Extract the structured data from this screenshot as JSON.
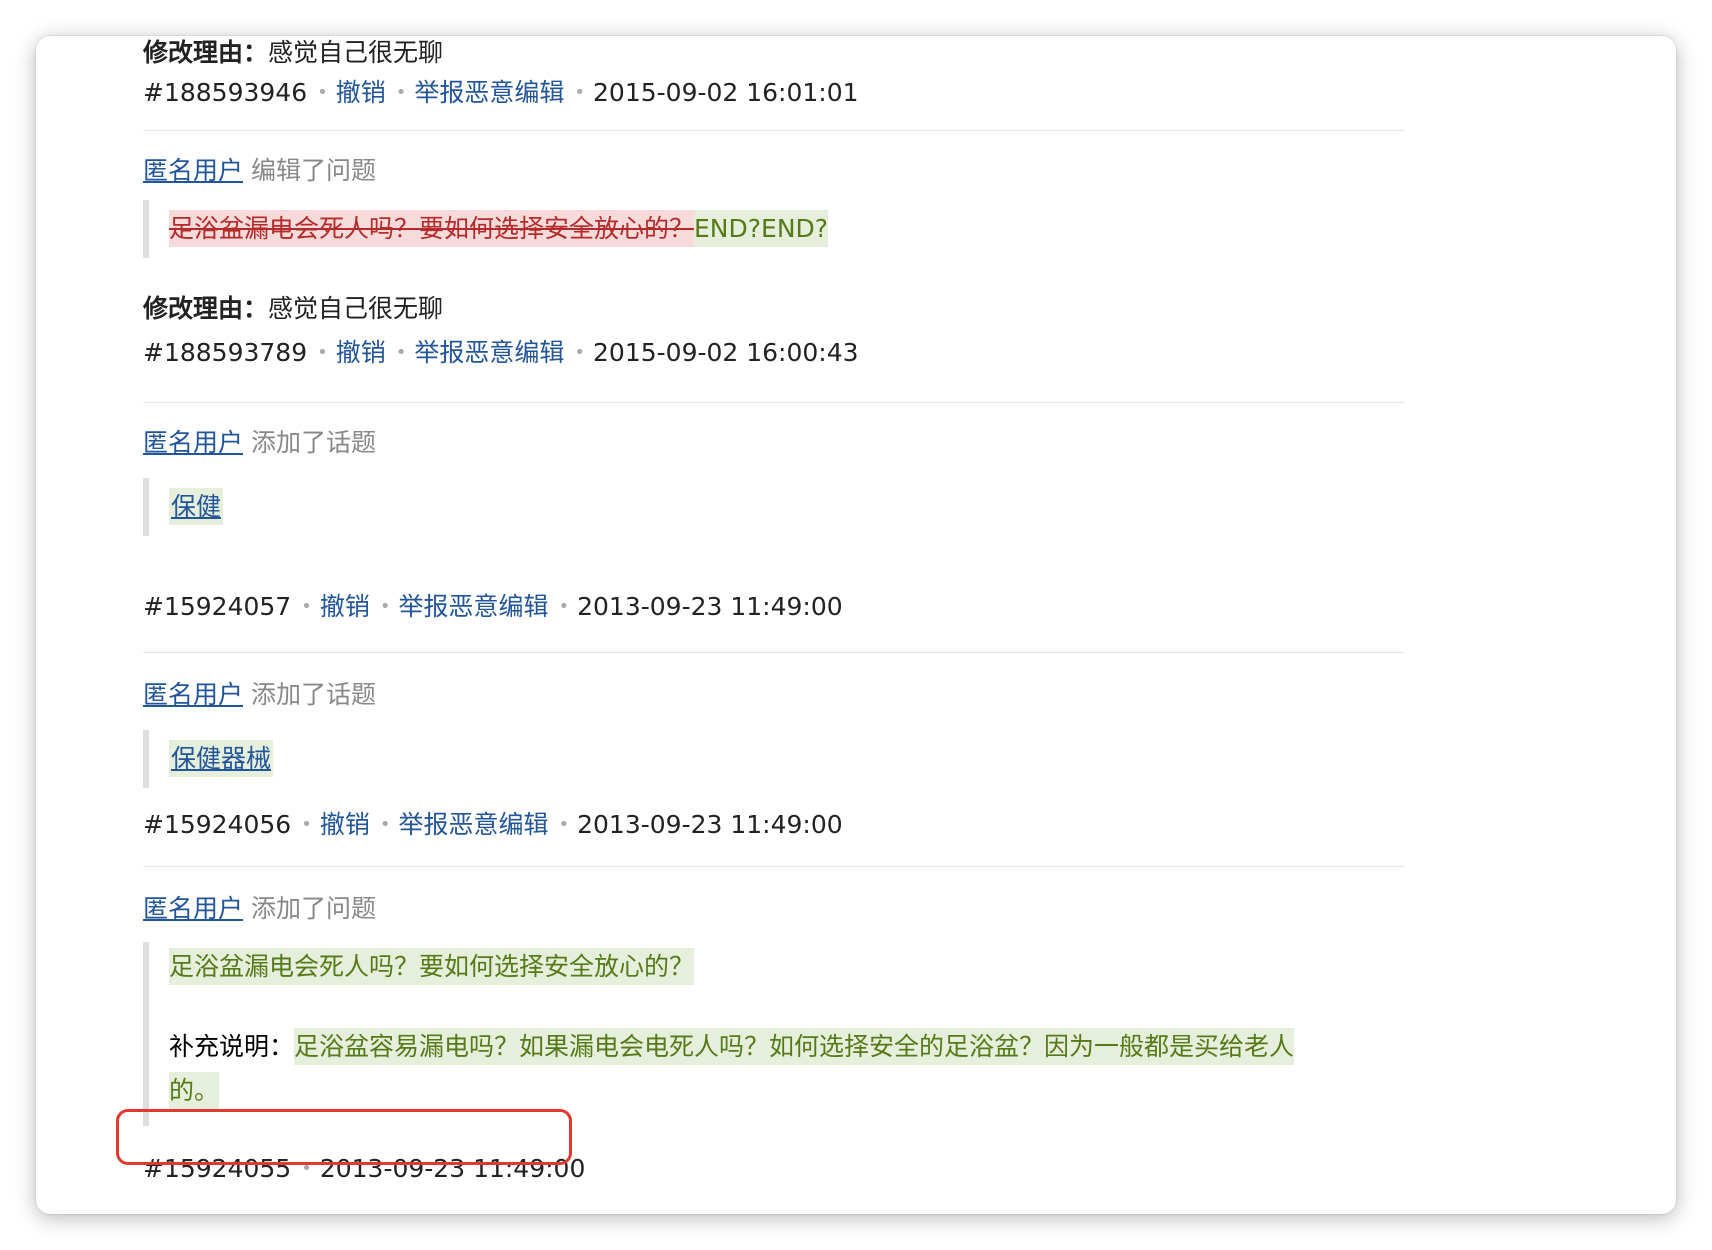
{
  "entries": [
    {
      "reason_label": "修改理由：",
      "reason_text": "感觉自己很无聊",
      "id": "#188593946",
      "undo": "撤销",
      "report": "举报恶意编辑",
      "time": "2015-09-02 16:01:01"
    },
    {
      "user": "匿名用户",
      "action": "编辑了问题",
      "removed": "足浴盆漏电会死人吗？要如何选择安全放心的？",
      "added": "END?END?",
      "reason_label": "修改理由：",
      "reason_text": "感觉自己很无聊",
      "id": "#188593789",
      "undo": "撤销",
      "report": "举报恶意编辑",
      "time": "2015-09-02 16:00:43"
    },
    {
      "user": "匿名用户",
      "action": "添加了话题",
      "topic": "保健",
      "id": "#15924057",
      "undo": "撤销",
      "report": "举报恶意编辑",
      "time": "2013-09-23 11:49:00"
    },
    {
      "user": "匿名用户",
      "action": "添加了话题",
      "topic": "保健器械",
      "id": "#15924056",
      "undo": "撤销",
      "report": "举报恶意编辑",
      "time": "2013-09-23 11:49:00"
    },
    {
      "user": "匿名用户",
      "action": "添加了问题",
      "question": "足浴盆漏电会死人吗？要如何选择安全放心的？",
      "supplement_label": "补充说明：",
      "supplement_line1": "足浴盆容易漏电吗？如果漏电会电死人吗？如何选择安全的足浴盆？因为一般都是买给老人",
      "supplement_line2": "的。",
      "id": "#15924055",
      "time": "2013-09-23 11:49:00"
    }
  ],
  "colors": {
    "link": "#225599",
    "deleted_bg": "#f7dada",
    "deleted_text": "#b52b2b",
    "inserted_bg": "#e6efdc",
    "inserted_text": "#557a17",
    "highlight_box": "#e03a2f"
  }
}
